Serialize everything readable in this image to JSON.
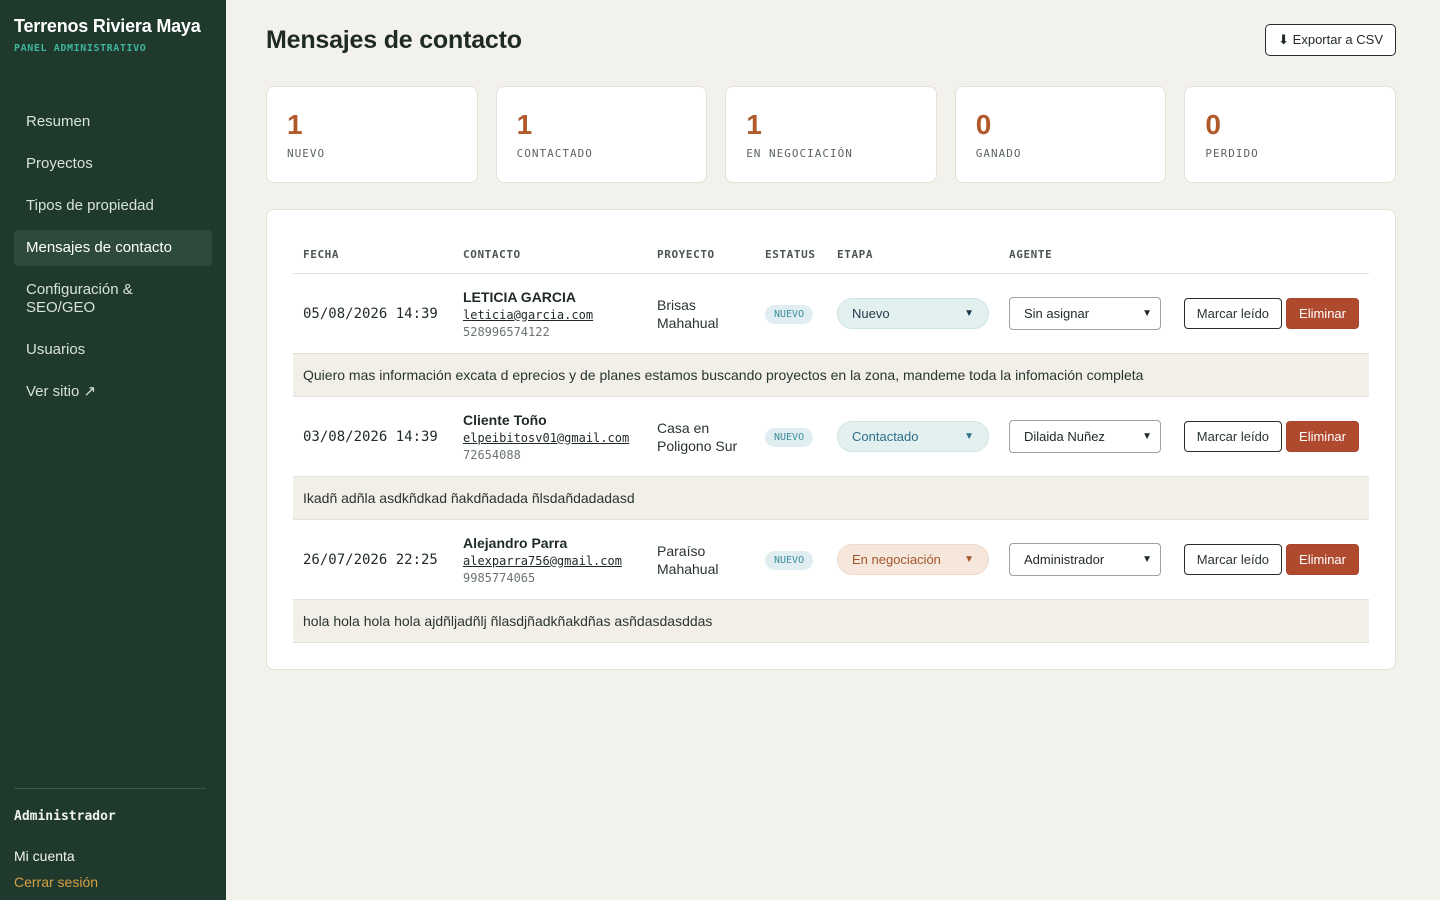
{
  "sidebar": {
    "brand": "Terrenos Riviera Maya",
    "subtitle": "PANEL ADMINISTRATIVO",
    "items": [
      {
        "label": "Resumen"
      },
      {
        "label": "Proyectos"
      },
      {
        "label": "Tipos de propiedad"
      },
      {
        "label": "Mensajes de contacto"
      },
      {
        "label": "Configuración & SEO/GEO"
      },
      {
        "label": "Usuarios"
      },
      {
        "label": "Ver sitio ↗"
      }
    ],
    "user": "Administrador",
    "account": "Mi cuenta",
    "logout": "Cerrar sesión"
  },
  "header": {
    "title": "Mensajes de contacto",
    "export": "⬇ Exportar a CSV"
  },
  "stats": [
    {
      "value": "1",
      "label": "NUEVO"
    },
    {
      "value": "1",
      "label": "CONTACTADO"
    },
    {
      "value": "1",
      "label": "EN NEGOCIACIÓN"
    },
    {
      "value": "0",
      "label": "GANADO"
    },
    {
      "value": "0",
      "label": "PERDIDO"
    }
  ],
  "table": {
    "headers": {
      "date": "FECHA",
      "contact": "CONTACTO",
      "project": "PROYECTO",
      "status": "ESTATUS",
      "stage": "ETAPA",
      "agent": "AGENTE"
    },
    "mark_read": "Marcar leído",
    "delete": "Eliminar",
    "rows": [
      {
        "date": "05/08/2026 14:39",
        "name": "LETICIA GARCIA",
        "email": "leticia@garcia.com",
        "phone": "528996574122",
        "project": "Brisas Mahahual",
        "status": "NUEVO",
        "stage": "Nuevo",
        "agent": "Sin asignar",
        "message": "Quiero mas información excata d eprecios y de planes estamos buscando proyectos en la zona, mandeme toda la infomación completa"
      },
      {
        "date": "03/08/2026 14:39",
        "name": "Cliente Toño",
        "email": "elpeibitosv01@gmail.com",
        "phone": "72654088",
        "project": "Casa en Poligono Sur",
        "status": "NUEVO",
        "stage": "Contactado",
        "agent": "Dilaida Nuñez",
        "message": "Ikadñ adñla asdkñdkad ñakdñadada ñlsdañdadadasd"
      },
      {
        "date": "26/07/2026 22:25",
        "name": "Alejandro Parra",
        "email": "alexparra756@gmail.com",
        "phone": "9985774065",
        "project": "Paraíso Mahahual",
        "status": "NUEVO",
        "stage": "En negociación",
        "agent": "Administrador",
        "message": "hola hola hola hola ajdñljadñlj ñlasdjñadkñakdñas asñdasdasddas"
      }
    ]
  }
}
